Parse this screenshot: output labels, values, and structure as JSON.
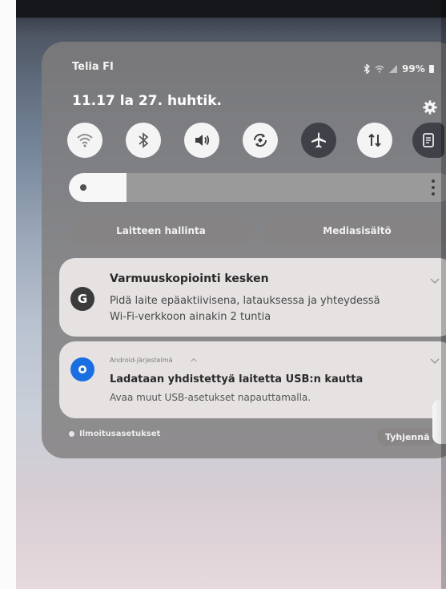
{
  "status_bar": {
    "carrier": "Telia FI",
    "battery": "99%"
  },
  "header": {
    "datetime": "11.17  la 27. huhtik."
  },
  "quick_settings": {
    "tiles": [
      {
        "icon": "wifi-icon",
        "active": true
      },
      {
        "icon": "bluetooth-icon",
        "active": true
      },
      {
        "icon": "sound-icon",
        "active": true
      },
      {
        "icon": "auto-rotate-icon",
        "active": true
      },
      {
        "icon": "airplane-mode-icon",
        "active": false
      },
      {
        "icon": "mobile-data-icon",
        "active": true
      },
      {
        "icon": "nfc-icon",
        "active": false
      }
    ],
    "brightness_level": 0.15
  },
  "buttons": {
    "device_control": "Laitteen hallinta",
    "media_output": "Mediasisältö"
  },
  "notifications": [
    {
      "app_icon": "google-icon",
      "app_letter": "G",
      "title": "Varmuuskopiointi kesken",
      "body_line1": "Pidä laite epäaktiivisena, latauksessa ja yhteydessä",
      "body_line2": "Wi-Fi-verkkoon ainakin 2 tuntia"
    },
    {
      "app_icon": "android-system-icon",
      "app_name": "Android-järjestelmä",
      "title": "Ladataan yhdistettyä laitetta USB:n kautta",
      "body": "Avaa muut USB-asetukset napauttamalla."
    }
  ],
  "footer": {
    "notification_settings": "Ilmoitusasetukset",
    "clear_all": "Tyhjennä"
  },
  "colors": {
    "tile_active": "#f4f4f4",
    "tile_inactive": "#3f4148",
    "panel": "#807e7e",
    "android_icon_blue": "#1a6fe0"
  }
}
